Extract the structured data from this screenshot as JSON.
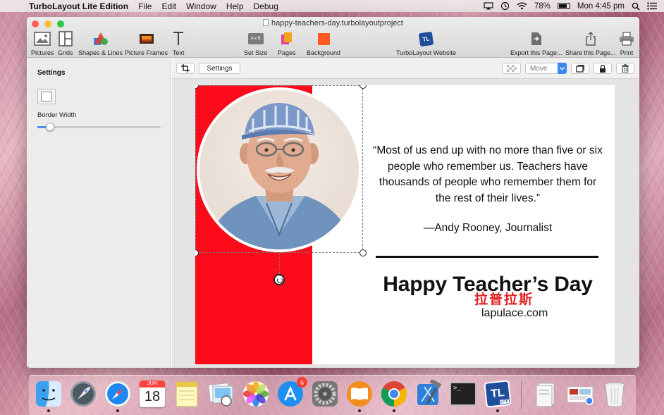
{
  "menubar": {
    "app_name": "TurboLayout Lite Edition",
    "items": [
      "File",
      "Edit",
      "Window",
      "Help",
      "Debug"
    ],
    "battery": "78%",
    "clock": "Mon 4:45 pm"
  },
  "window": {
    "title": "happy-teachers-day.turbolayoutproject"
  },
  "toolbar": {
    "pictures": "Pictures",
    "grids": "Grids",
    "shapes": "Shapes & Lines",
    "frames": "Picture Frames",
    "text": "Text",
    "set_size": "Set Size",
    "set_size_icon": "A x B",
    "pages": "Pages",
    "background": "Background",
    "website": "TurboLayout Website",
    "website_icon": "TL",
    "export": "Export this Page...",
    "share": "Share this Page...",
    "print": "Print"
  },
  "sidebar": {
    "title": "Settings",
    "border_width_label": "Border Width",
    "border_width_value": 0.1
  },
  "subbar": {
    "settings_button": "Settings",
    "move_select": "Move"
  },
  "canvas": {
    "quote": "“Most of us end up with no more than five or six people who remember us. Teachers have thousands of people who remember them for the rest of their lives.”",
    "author": "—Andy Rooney, Journalist",
    "headline": "Happy Teacher’s Day",
    "watermark_cn": "拉普拉斯",
    "watermark_url": "lapulace.com",
    "band_color": "#fe0b1b"
  },
  "dock": {
    "items": [
      "finder",
      "launchpad",
      "safari",
      "calendar",
      "notes",
      "preview",
      "photos",
      "app-store",
      "system-preferences",
      "ibooks",
      "chrome",
      "xcode",
      "terminal",
      "turbolayout",
      "documents",
      "photo-stack",
      "trash"
    ],
    "calendar_month": "JUN",
    "calendar_day": "18",
    "app_store_badge": "6",
    "terminal_prompt": ">_",
    "turbolayout_icon": "TL",
    "turbolayout_tag": "LITE"
  }
}
